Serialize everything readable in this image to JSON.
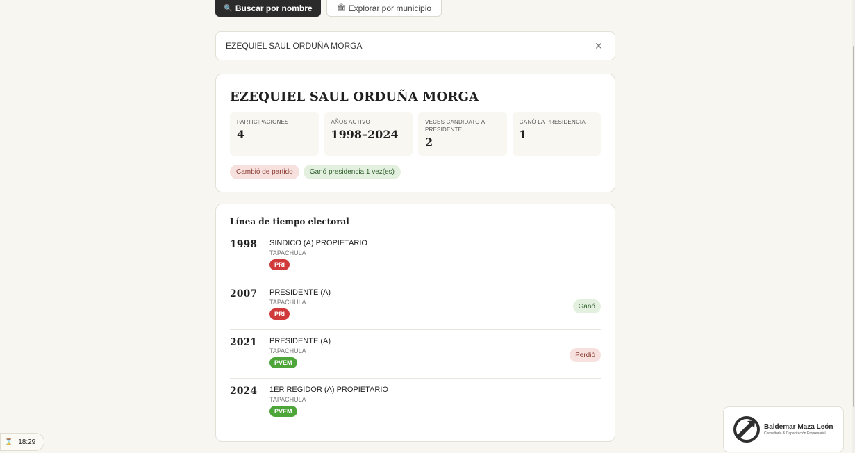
{
  "tabs": {
    "search": {
      "icon": "🔍",
      "label": "Buscar por nombre"
    },
    "explore": {
      "icon": "🏛",
      "label": "Explorar por municipio"
    }
  },
  "search": {
    "value": "EZEQUIEL SAUL ORDUÑA MORGA",
    "clear_icon": "✕"
  },
  "profile": {
    "name": "EZEQUIEL SAUL ORDUÑA MORGA",
    "stats": [
      {
        "label": "PARTICIPACIONES",
        "value": "4"
      },
      {
        "label": "AÑOS ACTIVO",
        "value": "1998–2024"
      },
      {
        "label": "VECES CANDIDATO A PRESIDENTE",
        "value": "2"
      },
      {
        "label": "GANÓ LA PRESIDENCIA",
        "value": "1"
      }
    ],
    "badges": [
      "Cambió de partido",
      "Ganó presidencia 1 vez(es)"
    ]
  },
  "timeline": {
    "title": "Línea de tiempo electoral",
    "entries": [
      {
        "year": "1998",
        "position": "SINDICO (A) PROPIETARIO",
        "place": "TAPACHULA",
        "party": "PRI",
        "result": ""
      },
      {
        "year": "2007",
        "position": "PRESIDENTE (A)",
        "place": "TAPACHULA",
        "party": "PRI",
        "result": "Ganó"
      },
      {
        "year": "2021",
        "position": "PRESIDENTE (A)",
        "place": "TAPACHULA",
        "party": "PVEM",
        "result": "Perdió"
      },
      {
        "year": "2024",
        "position": "1ER REGIDOR (A) PROPIETARIO",
        "place": "TAPACHULA",
        "party": "PVEM",
        "result": ""
      }
    ]
  },
  "party_colors": {
    "PRI": "#d03a3a",
    "PVEM": "#4ea63a"
  },
  "clock": {
    "icon": "⌛",
    "time": "18:29"
  },
  "logo": {
    "name": "Baldemar Maza León",
    "tagline": "Consultoría & Capacitación Empresarial"
  }
}
